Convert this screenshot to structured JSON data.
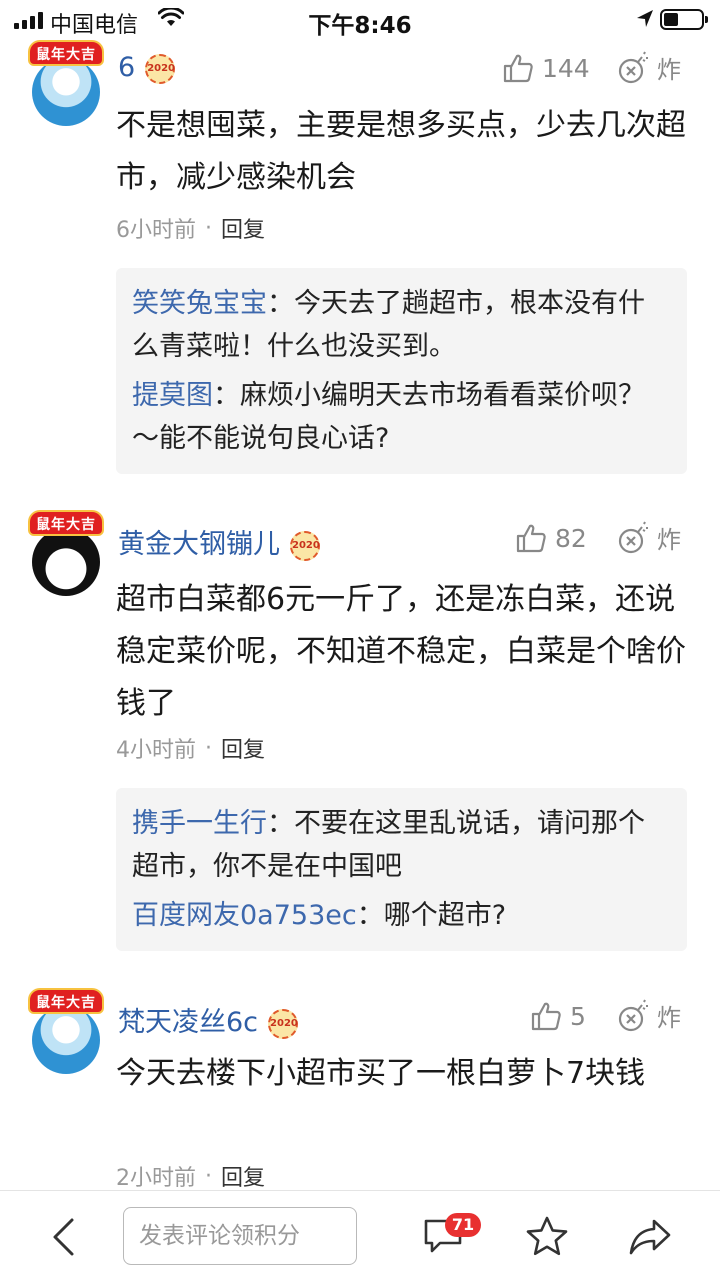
{
  "status_bar": {
    "carrier": "中国电信",
    "time": "下午8:46"
  },
  "comments": [
    {
      "avatar_badge": "鼠年大吉",
      "username": "6",
      "year_badge": "2020",
      "likes": "144",
      "bomb_label": "炸",
      "text": "不是想囤菜，主要是想多买点，少去几次超市，减少感染机会",
      "time": "6小时前",
      "reply_label": "回复",
      "replies": [
        {
          "user": "笑笑兔宝宝",
          "sep": "：",
          "text": "今天去了趟超市，根本没有什么青菜啦！什么也没买到。"
        },
        {
          "user": "提莫图",
          "sep": "：",
          "text": "麻烦小编明天去市场看看菜价呗？～能不能说句良心话?"
        }
      ]
    },
    {
      "avatar_badge": "鼠年大吉",
      "username": "黄金大钢镚儿",
      "year_badge": "2020",
      "likes": "82",
      "bomb_label": "炸",
      "text": "超市白菜都6元一斤了，还是冻白菜，还说稳定菜价呢，不知道不稳定，白菜是个啥价钱了",
      "time": "4小时前",
      "reply_label": "回复",
      "replies": [
        {
          "user": "携手一生行",
          "sep": "：",
          "text": "不要在这里乱说话，请问那个超市，你不是在中国吧"
        },
        {
          "user": "百度网友0a753ec",
          "sep": "：",
          "text": "哪个超市?"
        }
      ]
    },
    {
      "avatar_badge": "鼠年大吉",
      "username": "梵天凌丝6c",
      "year_badge": "2020",
      "likes": "5",
      "bomb_label": "炸",
      "text": "今天去楼下小超市买了一根白萝卜7块钱",
      "time": "2小时前",
      "reply_label": "回复",
      "replies": []
    }
  ],
  "bottom_bar": {
    "input_placeholder": "发表评论领积分",
    "comment_count": "71"
  },
  "icons": {
    "back": "chevron-left-icon",
    "comment": "speech-bubble-icon",
    "favorite": "star-icon",
    "share": "share-arrow-icon",
    "like": "thumbs-up-icon",
    "bomb": "bomb-icon"
  },
  "colors": {
    "username": "#2f5ea6",
    "reply_user": "#3d68ad",
    "badge_red": "#e02020",
    "count_badge": "#e83030",
    "reply_bg": "#f4f4f4",
    "meta_gray": "#999999"
  }
}
